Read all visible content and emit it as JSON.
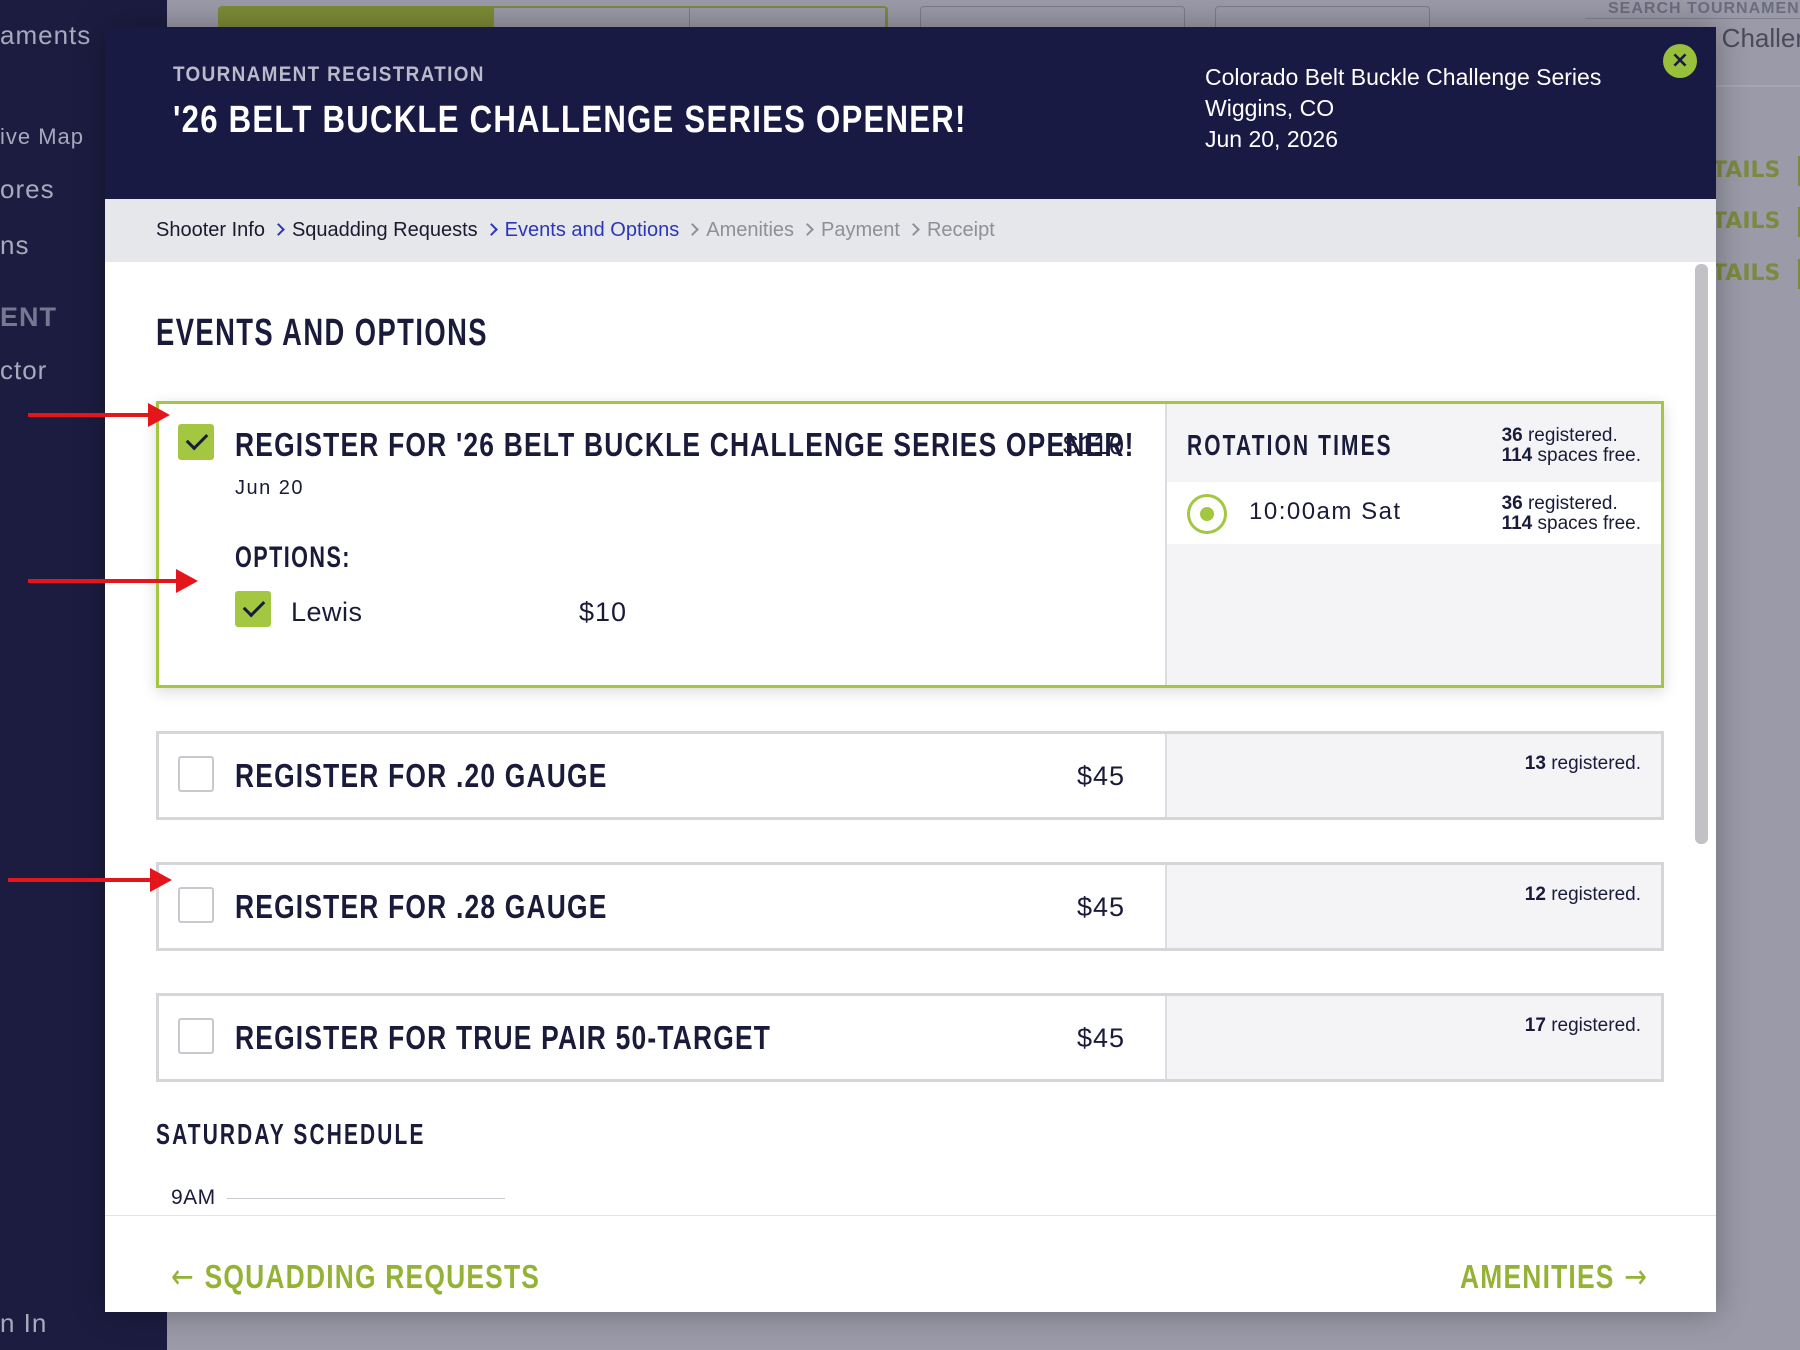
{
  "background": {
    "sidebar_items": [
      "aments",
      "ive Map",
      "ores",
      "ns",
      "ENT",
      "ctor",
      "n In"
    ],
    "search_label": "SEARCH TOURNAMEN",
    "search_value": "e Challen",
    "details_labels": [
      "TAILS",
      "TAILS",
      "TAILS"
    ]
  },
  "header": {
    "kicker": "TOURNAMENT REGISTRATION",
    "title": "'26 BELT BUCKLE CHALLENGE SERIES OPENER!",
    "series": "Colorado Belt Buckle Challenge Series",
    "location": "Wiggins, CO",
    "date": "Jun 20, 2026",
    "close_icon": "×"
  },
  "breadcrumb": [
    {
      "label": "Shooter Info",
      "state": "done"
    },
    {
      "label": "Squadding Requests",
      "state": "done"
    },
    {
      "label": "Events and Options",
      "state": "current"
    },
    {
      "label": "Amenities",
      "state": "future"
    },
    {
      "label": "Payment",
      "state": "future"
    },
    {
      "label": "Receipt",
      "state": "future"
    }
  ],
  "section_title": "EVENTS AND OPTIONS",
  "events": [
    {
      "name": "REGISTER FOR '26 BELT BUCKLE CHALLENGE SERIES OPENER!",
      "price": "$110",
      "date": "Jun 20",
      "checked": true,
      "options_title": "OPTIONS:",
      "options": [
        {
          "name": "Lewis",
          "price": "$10",
          "checked": true
        }
      ],
      "rotation_title": "ROTATION TIMES",
      "registered_count": "36",
      "registered_label": "registered.",
      "spaces_count": "114",
      "spaces_label": "spaces free.",
      "rotations": [
        {
          "label": "10:00am Sat",
          "selected": true,
          "registered_count": "36",
          "registered_label": "registered.",
          "spaces_count": "114",
          "spaces_label": "spaces free."
        }
      ]
    },
    {
      "name": "REGISTER FOR .20 GAUGE",
      "price": "$45",
      "checked": false,
      "registered_count": "13",
      "registered_label": "registered."
    },
    {
      "name": "REGISTER FOR .28 GAUGE",
      "price": "$45",
      "checked": false,
      "registered_count": "12",
      "registered_label": "registered."
    },
    {
      "name": "REGISTER FOR TRUE PAIR 50-TARGET",
      "price": "$45",
      "checked": false,
      "registered_count": "17",
      "registered_label": "registered."
    }
  ],
  "schedule": {
    "title": "SATURDAY SCHEDULE",
    "times": [
      "9AM"
    ]
  },
  "footer": {
    "prev_label": "SQUADDING REQUESTS",
    "next_label": "AMENITIES",
    "prev_arrow": "←",
    "next_arrow": "→"
  },
  "colors": {
    "navy": "#191a44",
    "accent_green": "#a3c740",
    "link_blue": "#2b37b5",
    "annotation_red": "#e4161b"
  }
}
